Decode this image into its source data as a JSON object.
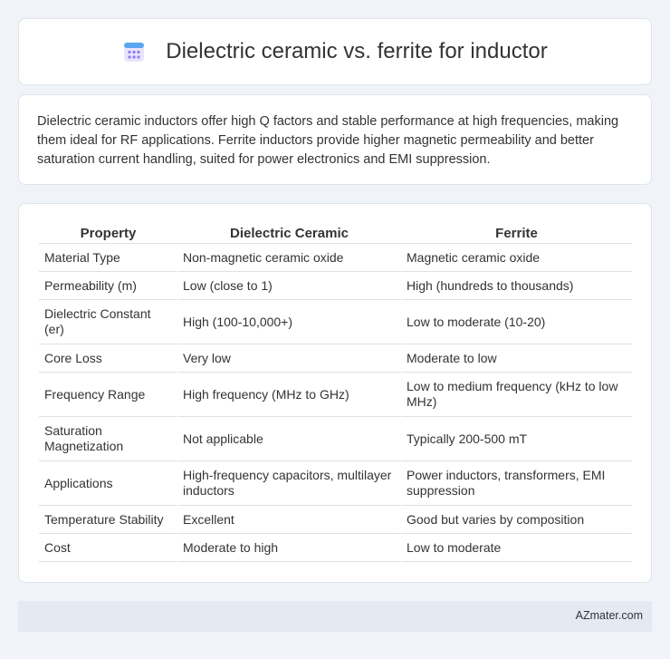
{
  "page": {
    "title": "Dielectric ceramic vs. ferrite for inductor",
    "icon": "calendar-icon"
  },
  "description": "Dielectric ceramic inductors offer high Q factors and stable performance at high frequencies, making them ideal for RF applications. Ferrite inductors provide higher magnetic permeability and better saturation current handling, suited for power electronics and EMI suppression.",
  "table": {
    "headers": [
      "Property",
      "Dielectric Ceramic",
      "Ferrite"
    ],
    "rows": [
      [
        "Material Type",
        "Non-magnetic ceramic oxide",
        "Magnetic ceramic oxide"
      ],
      [
        "Permeability (m)",
        "Low (close to 1)",
        "High (hundreds to thousands)"
      ],
      [
        "Dielectric Constant (er)",
        "High (100-10,000+)",
        "Low to moderate (10-20)"
      ],
      [
        "Core Loss",
        "Very low",
        "Moderate to low"
      ],
      [
        "Frequency Range",
        "High frequency (MHz to GHz)",
        "Low to medium frequency (kHz to low MHz)"
      ],
      [
        "Saturation Magnetization",
        "Not applicable",
        "Typically 200-500 mT"
      ],
      [
        "Applications",
        "High-frequency capacitors, multilayer inductors",
        "Power inductors, transformers, EMI suppression"
      ],
      [
        "Temperature Stability",
        "Excellent",
        "Good but varies by composition"
      ],
      [
        "Cost",
        "Moderate to high",
        "Low to moderate"
      ]
    ]
  },
  "footer": {
    "site": "AZmater.com"
  },
  "colors": {
    "background": "#f0f3f8",
    "card": "#ffffff",
    "footer": "#e4e9f2",
    "icon_accent": "#8e7cf0"
  }
}
